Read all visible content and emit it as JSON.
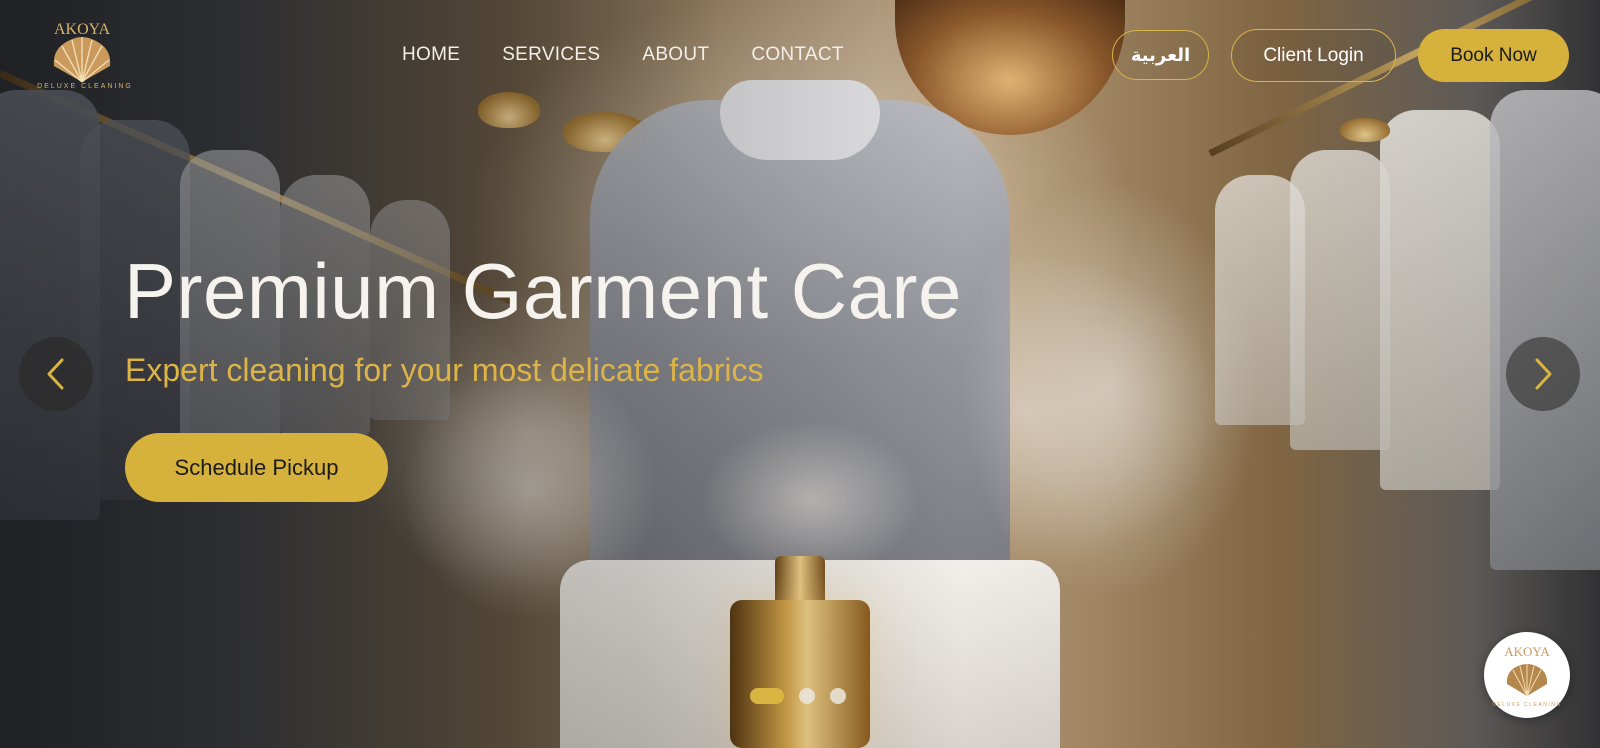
{
  "brand": {
    "logo_wordmark": "AKOYA",
    "logo_tagline": "DELUXE CLEANING",
    "logo_icon": "shell-icon"
  },
  "nav": {
    "items": [
      {
        "label": "HOME"
      },
      {
        "label": "SERVICES"
      },
      {
        "label": "ABOUT"
      },
      {
        "label": "CONTACT"
      }
    ]
  },
  "header_actions": {
    "language_label": "العربية",
    "login_label": "Client Login",
    "book_label": "Book Now"
  },
  "hero": {
    "title": "Premium Garment Care",
    "subtitle": "Expert cleaning for your most delicate fabrics",
    "cta_label": "Schedule Pickup"
  },
  "carousel": {
    "prev_icon": "chevron-left-icon",
    "next_icon": "chevron-right-icon",
    "slide_count": 3,
    "active_slide": 1
  },
  "floating_badge": {
    "wordmark": "AKOYA",
    "tagline": "DELUXE CLEANING"
  },
  "colors": {
    "accent_gold": "#d6b23d",
    "nav_text": "#f3efe8",
    "subtitle_gold": "#ddb448",
    "button_text_dark": "#1b1b1b"
  }
}
